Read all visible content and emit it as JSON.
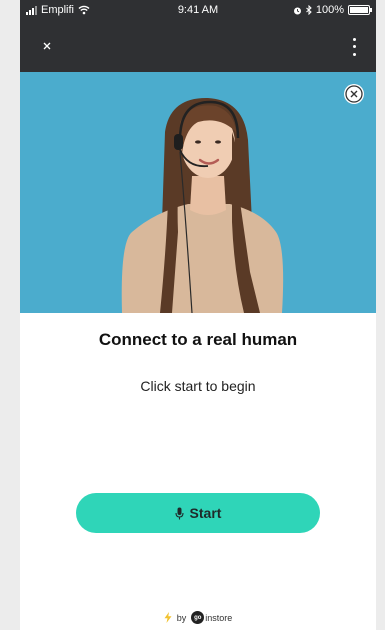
{
  "status_bar": {
    "carrier": "Emplifi",
    "time": "9:41 AM",
    "battery": "100%",
    "battery_level": 1.0,
    "icons": [
      "signal-icon",
      "wifi-icon",
      "alarm-icon",
      "bluetooth-icon",
      "battery-icon"
    ]
  },
  "app_bar": {
    "close_icon": "close-icon",
    "menu_icon": "more-vertical-icon"
  },
  "hero": {
    "dismiss_icon": "close-circle-icon",
    "background_color": "#4baccd"
  },
  "content": {
    "title": "Connect to a real human",
    "subtitle": "Click start to begin"
  },
  "start_button": {
    "icon": "microphone-icon",
    "label": "Start",
    "color": "#2fd5b8"
  },
  "footer": {
    "icon": "lightning-icon",
    "by": "by",
    "logo_text": "go",
    "brand": "instore"
  }
}
